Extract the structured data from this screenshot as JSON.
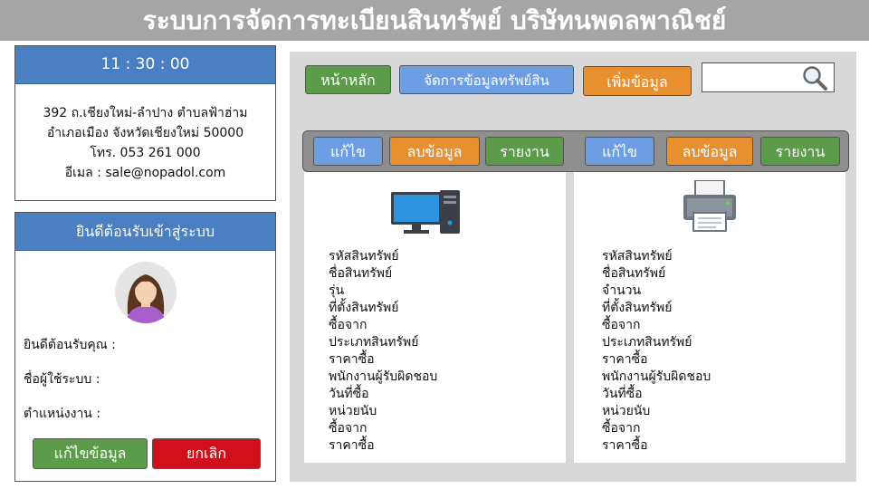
{
  "title": "ระบบการจัดการทะเบียนสินทรัพย์ บริษัทนพดลพาณิชย์",
  "clock": "11 : 30 : 00",
  "contact": {
    "line1": "392 ถ.เชียงใหม่-ลำปาง ตำบลฟ้าฮ่าม",
    "line2": "อำเภอเมือง จังหวัดเชียงใหม่ 50000",
    "phone": "โทร. 053 261 000",
    "email": "อีเมล : sale@nopadol.com"
  },
  "welcome": {
    "heading": "ยินดีต้อนรับเข้าสู่ระบบ",
    "greeting_label": "ยินดีต้อนรับคุณ :",
    "username_label": "ชื่อผู้ใช้ระบบ :",
    "position_label": "ตำแหน่งงาน :",
    "edit_button": "แก้ไขข้อมูล",
    "cancel_button": "ยกเลิก"
  },
  "nav": {
    "home": "หน้าหลัก",
    "manage": "จัดการข้อมูลทรัพย์สิน",
    "add": "เพิ่มข้อมูล"
  },
  "search": {
    "placeholder": ""
  },
  "actions": {
    "edit": "แก้ไข",
    "delete": "ลบข้อมูล",
    "report": "รายงาน"
  },
  "cards": [
    {
      "icon": "computer-icon",
      "fields": [
        "รหัสสินทรัพย์",
        "ชื่อสินทรัพย์",
        "รุ่น",
        "ที่ตั้งสินทรัพย์",
        "ซื้อจาก",
        "ประเภทสินทรัพย์",
        "ราคาซื้อ",
        "พนักงานผู้รับผิดชอบ",
        "วันที่ซื้อ",
        "หน่วยนับ",
        "ซื้อจาก",
        "ราคาซื้อ"
      ]
    },
    {
      "icon": "printer-icon",
      "fields": [
        "รหัสสินทรัพย์",
        "ชื่อสินทรัพย์",
        "จำนวน",
        "ที่ตั้งสินทรัพย์",
        "ซื้อจาก",
        "ประเภทสินทรัพย์",
        "ราคาซื้อ",
        "พนักงานผู้รับผิดชอบ",
        "วันที่ซื้อ",
        "หน่วยนับ",
        "ซื้อจาก",
        "ราคาซื้อ"
      ]
    }
  ],
  "colors": {
    "header_blue": "#4a7fc1",
    "green": "#5b9b4a",
    "orange": "#e88f30",
    "blue": "#6d9ee4",
    "red": "#d0101b"
  }
}
